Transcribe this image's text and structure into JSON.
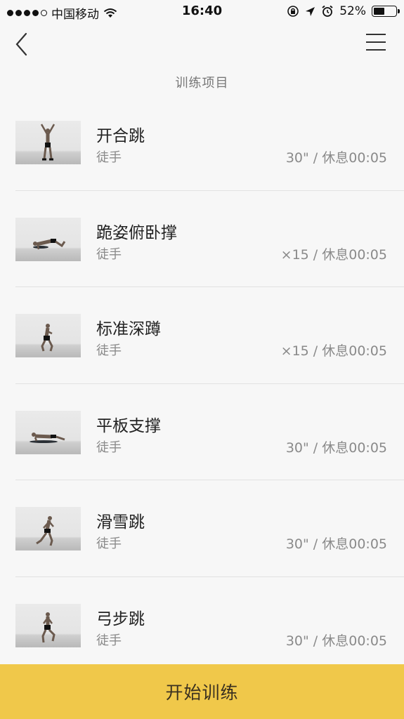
{
  "status_bar": {
    "carrier": "中国移动",
    "time": "16:40",
    "battery_percent": "52%",
    "battery_level": 0.52,
    "icons": [
      "signal-dots-icon",
      "wifi-icon",
      "orientation-lock-icon",
      "location-arrow-icon",
      "alarm-icon",
      "battery-icon"
    ]
  },
  "nav": {
    "title": "训练项目",
    "back_icon": "chevron-left-icon",
    "menu_icon": "hamburger-menu-icon"
  },
  "exercises": [
    {
      "name": "开合跳",
      "equipment": "徒手",
      "detail": "30\" / 休息00:05",
      "pose": "jumping-jack"
    },
    {
      "name": "跪姿俯卧撑",
      "equipment": "徒手",
      "detail": "×15 / 休息00:05",
      "pose": "kneeling-pushup"
    },
    {
      "name": "标准深蹲",
      "equipment": "徒手",
      "detail": "×15 / 休息00:05",
      "pose": "squat"
    },
    {
      "name": "平板支撑",
      "equipment": "徒手",
      "detail": "30\" / 休息00:05",
      "pose": "plank"
    },
    {
      "name": "滑雪跳",
      "equipment": "徒手",
      "detail": "30\" / 休息00:05",
      "pose": "skater-jump"
    },
    {
      "name": "弓步跳",
      "equipment": "徒手",
      "detail": "30\" / 休息00:05",
      "pose": "lunge-jump"
    }
  ],
  "start_button": {
    "label": "开始训练"
  },
  "colors": {
    "accent": "#f0c84a",
    "background": "#f7f7f7",
    "muted_text": "#8a8a8a"
  }
}
